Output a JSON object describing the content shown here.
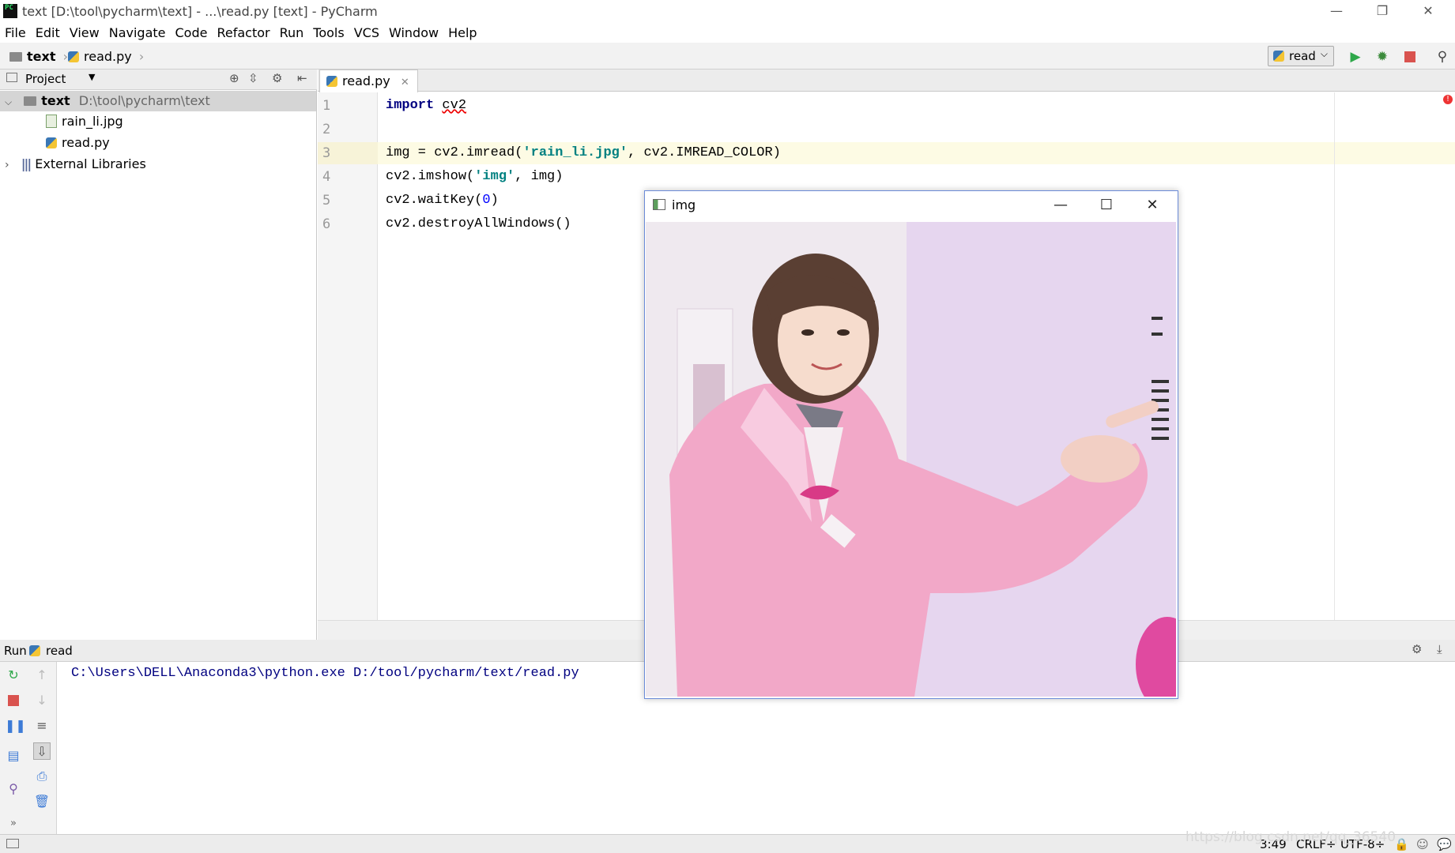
{
  "window": {
    "title": "text [D:\\tool\\pycharm\\text] - ...\\read.py [text] - PyCharm",
    "logo_text": "PC",
    "controls": {
      "minimize": "—",
      "restore": "❐",
      "close": "✕"
    }
  },
  "menu": [
    "File",
    "Edit",
    "View",
    "Navigate",
    "Code",
    "Refactor",
    "Run",
    "Tools",
    "VCS",
    "Window",
    "Help"
  ],
  "breadcrumb": {
    "project": "text",
    "file": "read.py"
  },
  "toolbar": {
    "run_config": "read"
  },
  "project_pane": {
    "header": "Project",
    "root_name": "text",
    "root_path": "D:\\tool\\pycharm\\text",
    "files": [
      "rain_li.jpg",
      "read.py"
    ],
    "libraries": "External Libraries"
  },
  "editor": {
    "tab": "read.py",
    "line_numbers": [
      "1",
      "2",
      "3",
      "4",
      "5",
      "6"
    ],
    "lines": {
      "l1_kw": "import",
      "l1_mod": "cv2",
      "l3_a": "img = cv2.imread(",
      "l3_str": "'rain_li.jpg'",
      "l3_b": ", cv2.IMREAD_COLOR)",
      "l4_a": "cv2.imshow(",
      "l4_str": "'img'",
      "l4_b": ", img)",
      "l5_a": "cv2.waitKey(",
      "l5_num": "0",
      "l5_b": ")",
      "l6": "cv2.destroyAllWindows()"
    }
  },
  "run_panel": {
    "label": "Run",
    "config": "read",
    "console_line": "C:\\Users\\DELL\\Anaconda3\\python.exe D:/tool/pycharm/text/read.py"
  },
  "image_window": {
    "title": "img",
    "controls": {
      "minimize": "—",
      "maximize": "☐",
      "close": "✕"
    }
  },
  "status_bar": {
    "position": "3:49",
    "line_sep": "CRLF÷",
    "encoding": "UTF-8÷",
    "watermark": "https://blog.csdn.net/qq_36540"
  }
}
